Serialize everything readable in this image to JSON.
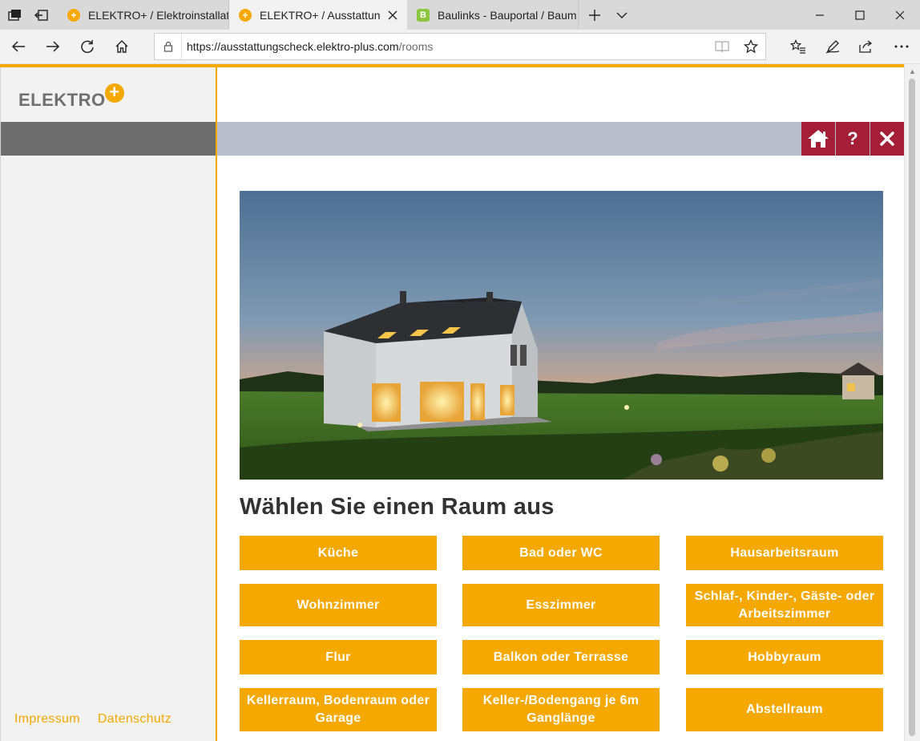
{
  "browser": {
    "tabs": [
      {
        "title": "ELEKTRO+ / Elektroinstallati",
        "favicon": "plus"
      },
      {
        "title": "ELEKTRO+ / Ausstattun",
        "favicon": "plus",
        "active": true
      },
      {
        "title": "Baulinks - Bauportal / Baum",
        "favicon": "B"
      }
    ],
    "url_host": "https://ausstattungscheck.elektro-plus.com",
    "url_path": "/rooms",
    "favicon_b_letter": "B"
  },
  "sidebar": {
    "logo_text": "ELEKTRO",
    "logo_plus": "+",
    "footer_links": [
      "Impressum",
      "Datenschutz"
    ]
  },
  "header_buttons": {
    "help_label": "?"
  },
  "main": {
    "title": "Wählen Sie einen Raum aus",
    "rooms": [
      "Küche",
      "Bad oder WC",
      "Hausarbeitsraum",
      "Wohnzimmer",
      "Esszimmer",
      "Schlaf-, Kinder-, Gäste- oder Arbeitszimmer",
      "Flur",
      "Balkon oder Terrasse",
      "Hobbyraum",
      "Kellerraum, Bodenraum oder Garage",
      "Keller-/Bodengang je 6m Ganglänge",
      "Abstellraum"
    ]
  },
  "colors": {
    "accent": "#f5a800",
    "header_button": "#a51e37",
    "graybar": "#b8bfca"
  }
}
